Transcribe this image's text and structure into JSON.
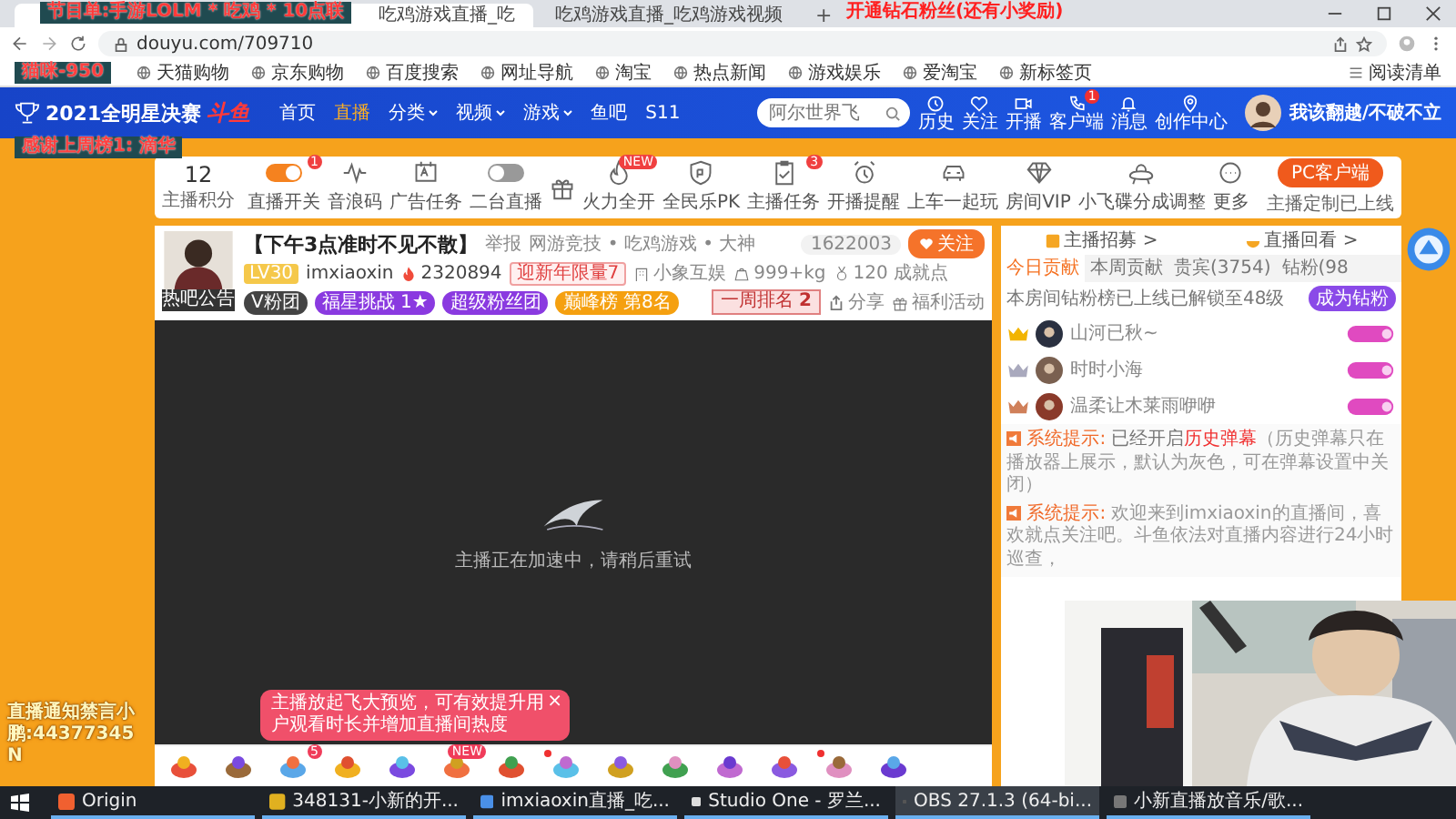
{
  "browser": {
    "tabs": [
      {
        "title": "吃鸡游戏直播_吃",
        "selected": true
      },
      {
        "title": "吃鸡游戏直播_吃鸡游戏视频",
        "selected": false
      }
    ],
    "new_tab": "+",
    "url": "douyu.com/709710",
    "bookmarks": [
      "天猫购物",
      "京东购物",
      "百度搜索",
      "网址导航",
      "淘宝",
      "热点新闻",
      "游戏娱乐",
      "爱淘宝",
      "新标签页"
    ],
    "reading_list": "阅读清单"
  },
  "stream_overlays": {
    "schedule": "节目单:手游LOLM * 吃鸡 * 10点联",
    "promo": "开通钻石粉丝(还有小奖励)",
    "gift_goal": "猫咪-950",
    "thanks": "感谢上周榜1: 滴华",
    "notice": "直播通知禁言小鹏:44377345N"
  },
  "site_nav": {
    "logo": "2021全明星决赛",
    "logo_mark": "斗鱼",
    "links": [
      {
        "label": "首页",
        "selected": false,
        "dropdown": false
      },
      {
        "label": "直播",
        "selected": true,
        "dropdown": false
      },
      {
        "label": "分类",
        "selected": false,
        "dropdown": true
      },
      {
        "label": "视频",
        "selected": false,
        "dropdown": true
      },
      {
        "label": "游戏",
        "selected": false,
        "dropdown": true
      },
      {
        "label": "鱼吧",
        "selected": false,
        "dropdown": false
      },
      {
        "label": "S11",
        "selected": false,
        "dropdown": false
      }
    ],
    "search": {
      "placeholder": "阿尔世界飞"
    },
    "actions": [
      {
        "label": "历史"
      },
      {
        "label": "关注"
      },
      {
        "label": "开播"
      },
      {
        "label": "客户端",
        "badge": "1"
      },
      {
        "label": "消息"
      },
      {
        "label": "创作中心"
      }
    ],
    "user": "我该翻越/不破不立"
  },
  "toolbar": {
    "score": "12",
    "score_label": "主播积分",
    "items": [
      {
        "kind": "switch",
        "label": "直播开关",
        "on": true,
        "badge": "1"
      },
      {
        "kind": "button",
        "label": "音浪码"
      },
      {
        "kind": "button",
        "label": "广告任务"
      },
      {
        "kind": "switch",
        "label": "二台直播",
        "on": false
      },
      {
        "kind": "button"
      },
      {
        "kind": "button",
        "label": "火力全开",
        "badge": "NEW"
      },
      {
        "kind": "button",
        "label": "全民乐PK"
      },
      {
        "kind": "button",
        "label": "主播任务",
        "badge": "3"
      },
      {
        "kind": "button",
        "label": "开播提醒"
      },
      {
        "kind": "button",
        "label": "上车一起玩"
      },
      {
        "kind": "button",
        "label": "房间VIP"
      },
      {
        "kind": "button",
        "label": "小飞碟分成调整"
      },
      {
        "kind": "button",
        "label": "更多"
      }
    ],
    "client_button": "PC客户端",
    "client_caption": "主播定制已上线"
  },
  "stream": {
    "avatar_tabs": [
      "热吧",
      "公告"
    ],
    "title": "【下午3点准时不见不散】",
    "report": "举报",
    "category": "网游竞技 • 吃鸡游戏 • 大神",
    "follower_count": "1622003",
    "follow": "关注",
    "level": "LV30",
    "streamer": "imxiaoxin",
    "heat": "2320894",
    "event_badge": "迎新年限量7",
    "company": "小象互娱",
    "weight": "999+kg",
    "achievements": "120 成就点",
    "pills": [
      {
        "kind": "dark",
        "label": "V粉团"
      },
      {
        "kind": "purple",
        "label": "福星挑战",
        "extra": "1★"
      },
      {
        "kind": "purple",
        "label": "超级粉丝团"
      },
      {
        "kind": "gold",
        "label": "巅峰榜",
        "extra": "第8名"
      }
    ],
    "rank_banner": "一周排名",
    "rank_number": "2",
    "share": "分享",
    "favorite": "福利活动",
    "video_status": "主播正在加速中，请稍后重试",
    "popup": "主播放起飞大预览，可有效提升用户观看时长并增加直播间热度",
    "popup_close": "×",
    "gifts": [
      {
        "dot": false
      },
      {
        "dot": false
      },
      {
        "dot": false,
        "badge": "5"
      },
      {
        "dot": false
      },
      {
        "dot": false
      },
      {
        "dot": false,
        "badge": "NEW"
      },
      {
        "dot": false
      },
      {
        "dot": true
      },
      {
        "dot": false
      },
      {
        "dot": false
      },
      {
        "dot": false
      },
      {
        "dot": false
      },
      {
        "dot": true
      },
      {
        "dot": false
      }
    ]
  },
  "side_panel": {
    "links": [
      "主播招募 >",
      "直播回看 >"
    ],
    "tabs": [
      {
        "label": "今日贡献",
        "selected": true
      },
      {
        "label": "本周贡献",
        "selected": false
      },
      {
        "label": "贵宾(3754)",
        "selected": false
      },
      {
        "label": "钻粉(98",
        "selected": false
      }
    ],
    "notice": "本房间钻粉榜已上线已解锁至48级",
    "notice_button": "成为钻粉",
    "ranks": [
      {
        "name": "山河已秋~",
        "color": "#f2b400"
      },
      {
        "name": "时时小海",
        "color": "#a9a9bd"
      },
      {
        "name": "温柔让木莱雨咿咿",
        "color": "#d0805a"
      }
    ],
    "chat": [
      {
        "segments": [
          {
            "kind": "label",
            "text": "系统提示:"
          },
          {
            "kind": "plain",
            "text": "已经开启"
          },
          {
            "kind": "alert",
            "text": "历史弹幕"
          },
          {
            "kind": "note",
            "text": "（历史弹幕只在播放器上展示，默认为灰色，可在弹幕设置中关闭）"
          }
        ]
      },
      {
        "segments": [
          {
            "kind": "label",
            "text": "系统提示:"
          },
          {
            "kind": "note",
            "text": "欢迎来到imxiaoxin的直播间，喜欢就点关注吧。斗鱼依法对直播内容进行24小时巡查，"
          }
        ]
      }
    ]
  },
  "taskbar": {
    "items": [
      {
        "label": "Origin",
        "selected": false
      },
      {
        "label": "348131-小新的开...",
        "selected": false
      },
      {
        "label": "imxiaoxin直播_吃...",
        "selected": false
      },
      {
        "label": "Studio One - 罗兰...",
        "selected": false
      },
      {
        "label": "OBS 27.1.3 (64-bi...",
        "selected": true
      },
      {
        "label": "小新直播放音乐/歌...",
        "selected": false
      }
    ]
  }
}
